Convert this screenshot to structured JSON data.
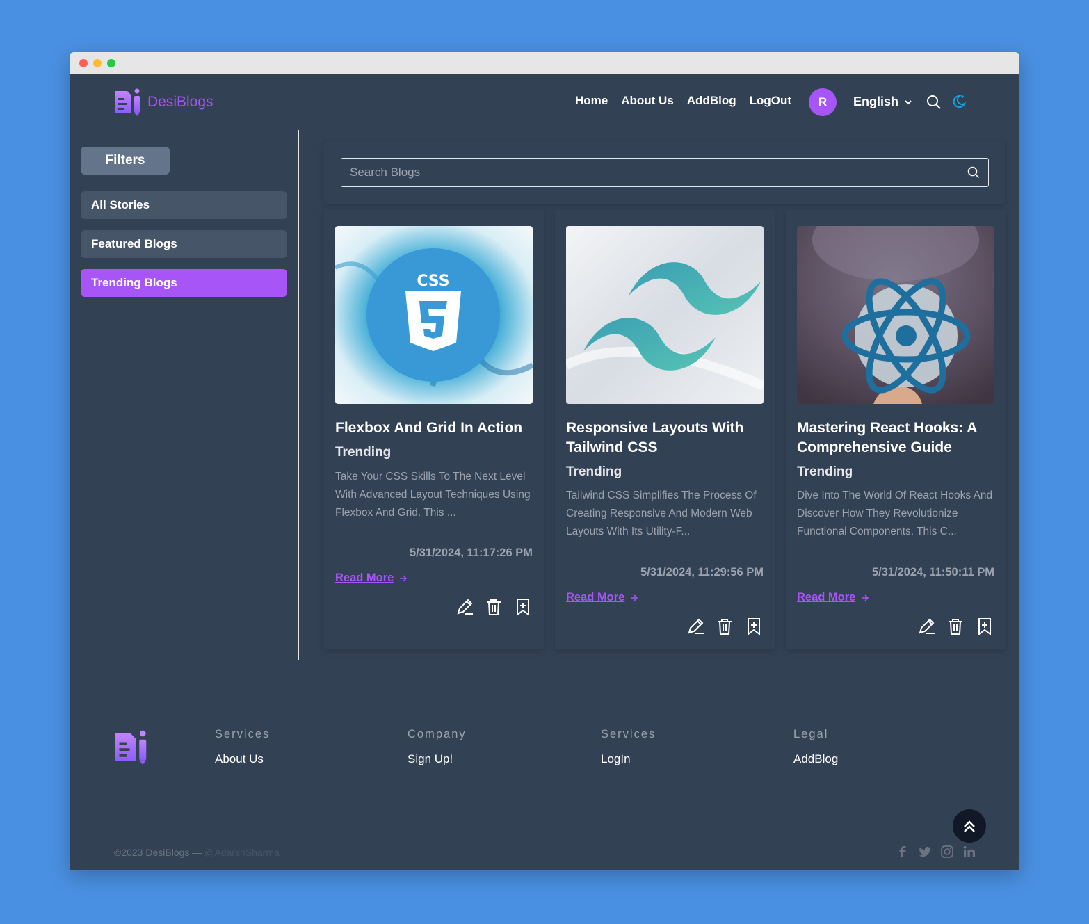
{
  "app": {
    "name": "DesiBlogs"
  },
  "nav": {
    "links": [
      "Home",
      "About Us",
      "AddBlog",
      "LogOut"
    ],
    "avatar_initial": "R",
    "language": "English"
  },
  "sidebar": {
    "filters_label": "Filters",
    "items": [
      {
        "label": "All Stories",
        "active": false
      },
      {
        "label": "Featured Blogs",
        "active": false
      },
      {
        "label": "Trending Blogs",
        "active": true
      }
    ]
  },
  "search": {
    "placeholder": "Search Blogs"
  },
  "posts": [
    {
      "title": "Flexbox And Grid In Action",
      "category": "Trending",
      "description": "Take Your CSS Skills To The Next Level With Advanced Layout Techniques Using Flexbox And Grid. This ...",
      "date": "5/31/2024, 11:17:26 PM",
      "read_more": "Read More",
      "image": "css3-logo"
    },
    {
      "title": "Responsive Layouts With Tailwind CSS",
      "category": "Trending",
      "description": "Tailwind CSS Simplifies The Process Of Creating Responsive And Modern Web Layouts With Its Utility-F...",
      "date": "5/31/2024, 11:29:56 PM",
      "read_more": "Read More",
      "image": "tailwind-logo"
    },
    {
      "title": "Mastering React Hooks: A Comprehensive Guide",
      "category": "Trending",
      "description": "Dive Into The World Of React Hooks And Discover How They Revolutionize Functional Components. This C...",
      "date": "5/31/2024, 11:50:11 PM",
      "read_more": "Read More",
      "image": "react-logo"
    }
  ],
  "footer": {
    "columns": [
      {
        "heading": "Services",
        "link": "About Us"
      },
      {
        "heading": "Company",
        "link": "Sign Up!"
      },
      {
        "heading": "Services",
        "link": "LogIn"
      },
      {
        "heading": "Legal",
        "link": "AddBlog"
      }
    ],
    "copyright": "©2023 DesiBlogs —",
    "handle": "@AdarshSharma",
    "socials": [
      "facebook-icon",
      "twitter-icon",
      "instagram-icon",
      "linkedin-icon"
    ]
  },
  "colors": {
    "accent": "#a855f7",
    "background": "#334155",
    "page": "#4a90e2"
  }
}
